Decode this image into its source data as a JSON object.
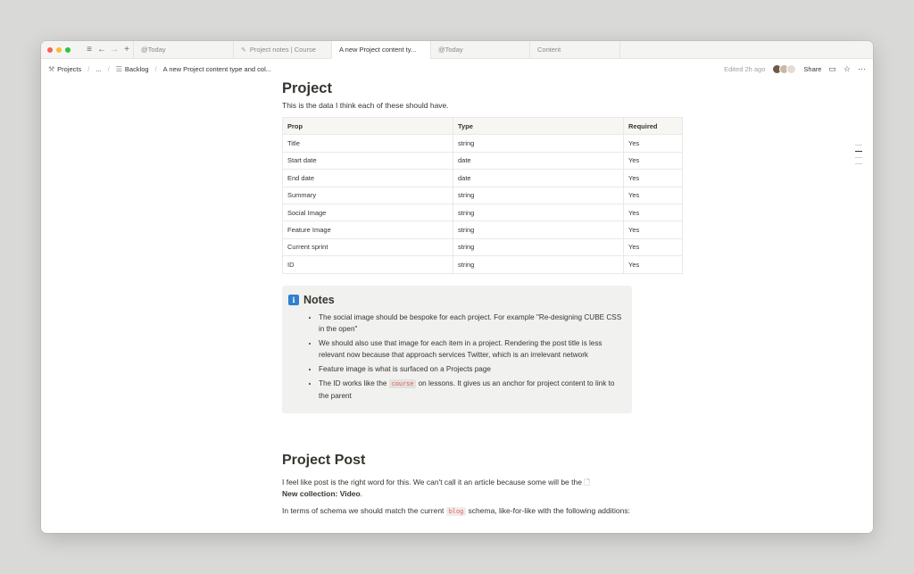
{
  "colors": {
    "light_red": "#fe5f57",
    "light_yellow": "#febc2e",
    "light_green": "#28c840",
    "accent_red": "#eb5757",
    "callout_bg": "#f1f1ef"
  },
  "tabs": [
    {
      "label": "@Today",
      "icon": "",
      "active": false
    },
    {
      "label": "Project notes | Course",
      "icon": "edit-icon",
      "active": false
    },
    {
      "label": "A new Project content ty...",
      "icon": "",
      "active": true
    },
    {
      "label": "@Today",
      "icon": "",
      "active": false
    },
    {
      "label": "Content",
      "icon": "",
      "active": false
    }
  ],
  "breadcrumb": {
    "projects": "Projects",
    "ellipsis": "...",
    "backlog": "Backlog",
    "page": "A new Project content type and col...",
    "sep": "/"
  },
  "topbar": {
    "edited": "Edited 2h ago",
    "share": "Share"
  },
  "project": {
    "heading": "Project",
    "intro": "This is the data I think each of these should have.",
    "table": {
      "headers": [
        "Prop",
        "Type",
        "Required"
      ],
      "rows": [
        [
          "Title",
          "string",
          "Yes"
        ],
        [
          "Start date",
          "date",
          "Yes"
        ],
        [
          "End date",
          "date",
          "Yes"
        ],
        [
          "Summary",
          "string",
          "Yes"
        ],
        [
          "Social Image",
          "string",
          "Yes"
        ],
        [
          "Feature Image",
          "string",
          "Yes"
        ],
        [
          "Current sprint",
          "string",
          "Yes"
        ],
        [
          "ID",
          "string",
          "Yes"
        ]
      ]
    }
  },
  "notes": {
    "title": "Notes",
    "items": {
      "n1": "The social image should be bespoke for each project. For example \"Re-designing CUBE CSS in the open\"",
      "n2": "We should also use that image for each item in a project. Rendering the post title is less relevant now because that approach services Twitter, which is an irrelevant network",
      "n3": "Feature image is what is surfaced on a Projects page",
      "n4_before": "The ID works like the",
      "n4_code": "course",
      "n4_after": "on lessons. It gives us an anchor for project content to link to the parent"
    }
  },
  "post": {
    "heading": "Project Post",
    "p1": "I feel like post is the right word for this. We can't call it an article because some will be the",
    "p1_bold": "New collection: Video",
    "p1_end": ".",
    "p2_before": "In terms of schema we should match the current",
    "p2_code": "blog",
    "p2_after": "schema, like-for-like with the following additions:"
  }
}
